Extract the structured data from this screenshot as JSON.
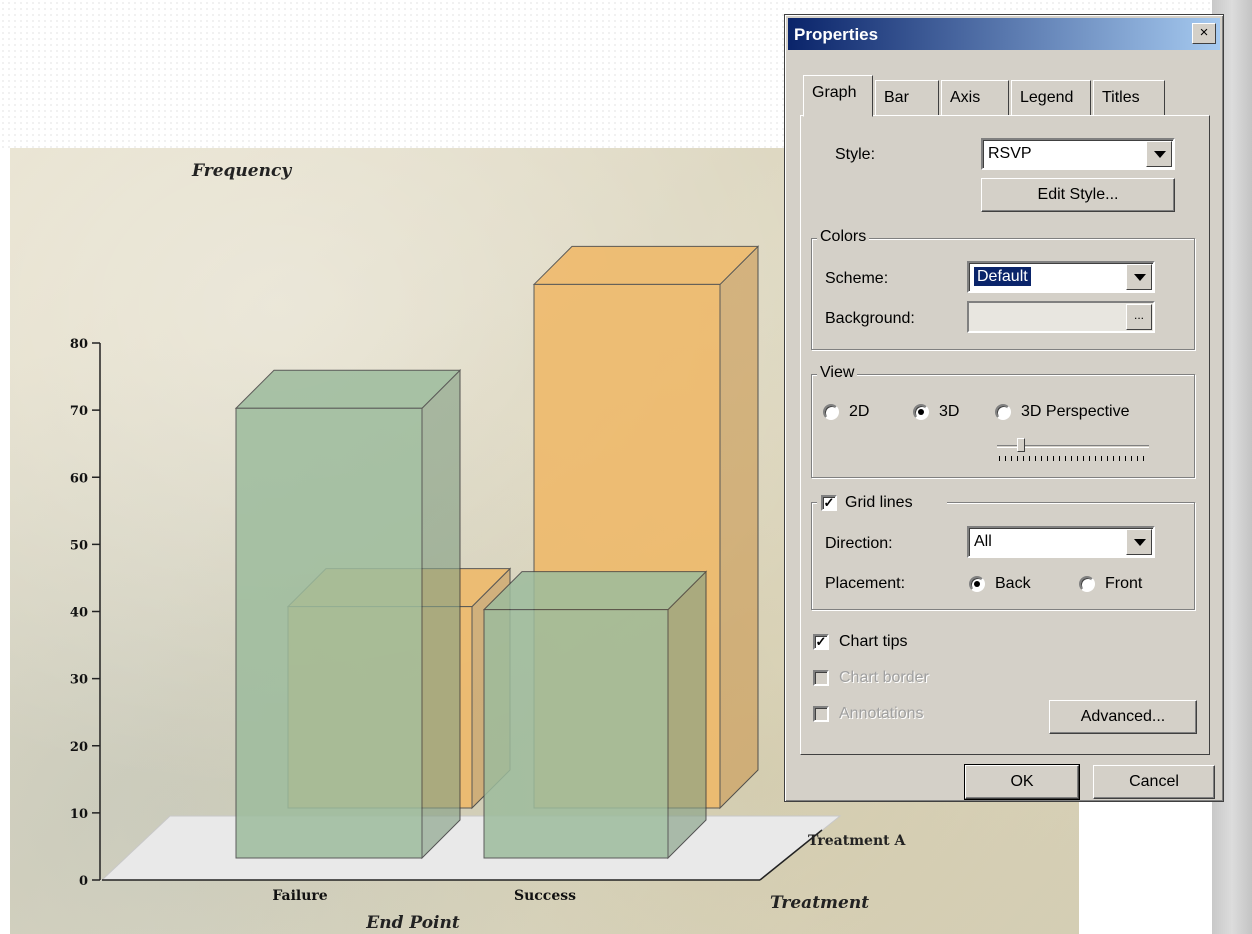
{
  "chart_data": {
    "type": "bar",
    "title": "",
    "ylabel": "Frequency",
    "xlabel": "End Point",
    "zlabel": "Treatment",
    "categories": [
      "Failure",
      "Success"
    ],
    "ylim": [
      0,
      80
    ],
    "yticks": [
      "0",
      "10",
      "20",
      "30",
      "40",
      "50",
      "60",
      "70",
      "80"
    ],
    "series": [
      {
        "name": "Treatment A",
        "values": [
          67,
          37
        ],
        "color": "#9dbc9d"
      },
      {
        "name": "",
        "values": [
          30,
          78
        ],
        "color": "#f0b866"
      }
    ],
    "view": "3D",
    "grid": false
  },
  "dialog": {
    "title": "Properties",
    "close_glyph": "×",
    "tabs": [
      "Graph",
      "Bar",
      "Axis",
      "Legend",
      "Titles"
    ],
    "active_tab": "Graph",
    "style": {
      "label": "Style:",
      "value": "RSVP",
      "edit_button": "Edit Style..."
    },
    "colors": {
      "group": "Colors",
      "scheme_label": "Scheme:",
      "scheme_value": "Default",
      "background_label": "Background:",
      "background_button": "..."
    },
    "view": {
      "group": "View",
      "options": [
        "2D",
        "3D",
        "3D Perspective"
      ],
      "selected": "3D"
    },
    "grid_lines": {
      "label": "Grid lines",
      "checked": true,
      "direction_label": "Direction:",
      "direction_value": "All",
      "placement_label": "Placement:",
      "placement_options": [
        "Back",
        "Front"
      ],
      "placement_selected": "Back"
    },
    "chart_tips": {
      "label": "Chart tips",
      "checked": true
    },
    "chart_border": {
      "label": "Chart border",
      "checked": false,
      "enabled": false
    },
    "annotations": {
      "label": "Annotations",
      "checked": false,
      "enabled": false
    },
    "advanced_button": "Advanced...",
    "ok_button": "OK",
    "cancel_button": "Cancel",
    "check_glyph": "✓"
  }
}
